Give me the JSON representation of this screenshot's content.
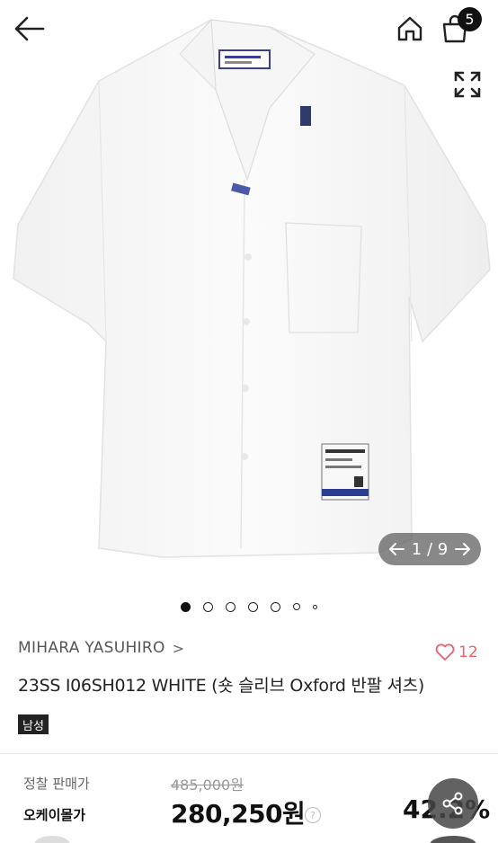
{
  "topbar": {
    "back_icon": "arrow-left-icon",
    "home_icon": "home-icon",
    "cart_icon": "shopping-bag-icon",
    "cart_count": "5",
    "expand_icon": "fullscreen-icon"
  },
  "gallery": {
    "counter": "1 / 9",
    "prev_icon": "arrow-left-icon",
    "next_icon": "arrow-right-icon",
    "dots_total": 7,
    "active_dot": 0
  },
  "product": {
    "brand": "MIHARA YASUHIRO",
    "brand_chevron": ">",
    "likes": "12",
    "title": "23SS   I06SH012 WHITE (숏 슬리브 Oxford 반팔 셔츠)",
    "gender_tag": "남성"
  },
  "price": {
    "list_label": "정찰 판매가",
    "original_price": "485,000원",
    "sale_label": "오케이몰가",
    "sale_price": "280,250원",
    "help_icon": "?",
    "discount": "42.2%"
  },
  "colors": {
    "like": "#e8646a",
    "badge": "#111111",
    "counter_bg": "#5a5a5a"
  }
}
